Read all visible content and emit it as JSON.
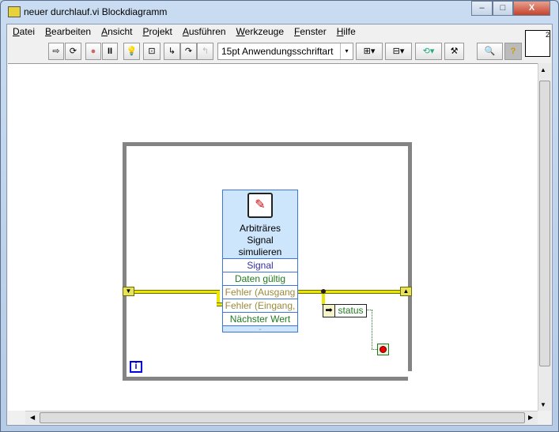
{
  "window": {
    "title": "neuer durchlauf.vi Blockdiagramm",
    "minimize": "–",
    "maximize": "□",
    "close": "X"
  },
  "menu": [
    "Datei",
    "Bearbeiten",
    "Ansicht",
    "Projekt",
    "Ausführen",
    "Werkzeuge",
    "Fenster",
    "Hilfe"
  ],
  "toolbar": {
    "font": "15pt Anwendungsschriftart",
    "dropdown": "▾",
    "vi_icon_number": "2"
  },
  "diagram": {
    "node": {
      "title_lines": [
        "Arbiträres",
        "Signal",
        "simulieren"
      ],
      "terminals": [
        "Signal",
        "Daten gültig",
        "Fehler (Ausgang",
        "Fehler (Eingang,",
        "Nächster Wert"
      ],
      "terminal_colors": [
        "#3030a0",
        "#1f7a1f",
        "#9b8a3a",
        "#9b8a3a",
        "#1f7a1f"
      ]
    },
    "unbundle_label": "status",
    "iteration": "i"
  }
}
